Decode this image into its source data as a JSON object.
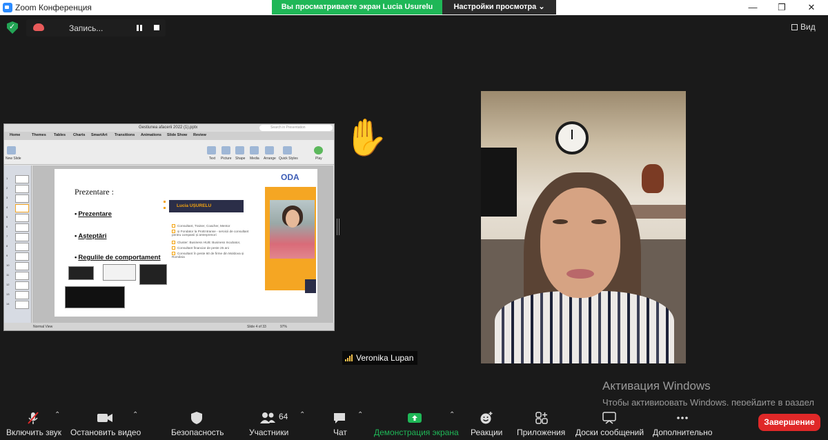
{
  "window": {
    "title": "Zoom Конференция",
    "controls": [
      "—",
      "❐",
      "✕"
    ]
  },
  "share_banner": {
    "text": "Вы просматриваете экран Lucia Usurelu",
    "view_settings": "Настройки просмотра"
  },
  "recording": {
    "label": "Запись..."
  },
  "view_button": "Вид",
  "shared_screen": {
    "file_name": "Gestiunea afacerii 2022 (1).pptx",
    "search_placeholder": "Search in Presentation",
    "tabs": [
      "Home",
      "Themes",
      "Tables",
      "Charts",
      "SmartArt",
      "Transitions",
      "Animations",
      "Slide Show",
      "Review"
    ],
    "ribbon_items": [
      "New Slide",
      "Text",
      "Picture",
      "Shape",
      "Media",
      "Arrange",
      "Quick Styles",
      "Play"
    ],
    "slide": {
      "title": "Prezentare :",
      "bullets": [
        "Prezentare",
        "Așteptări",
        "Regulile de comportament"
      ],
      "presenter_name": "Lucia UȘURELU",
      "bio": [
        "Consultant, Trainer, Coacher, Mentor",
        "și Fondator la ProEntranse - servicii de consultant pentru companii și antreprenori",
        "Cluster: Business HUB: Business Incubator,",
        "Consultant  financiar de peste 25 ani",
        "Consultant  în peste 60 de firme din Moldova și România"
      ],
      "logo": "ODA"
    },
    "status": {
      "view": "Normal View",
      "slide": "Slide 4 of 33",
      "zoom": "97%"
    }
  },
  "participant": {
    "name": "Veronika Lupan"
  },
  "windows_activation": {
    "title": "Активация Windows",
    "text": "Чтобы активировать Windows, перейдите в раздел \"Параметры\"."
  },
  "toolbar": {
    "unmute": "Включить звук",
    "stop_video": "Остановить видео",
    "security": "Безопасность",
    "participants": "Участники",
    "participants_count": "64",
    "chat": "Чат",
    "share_screen": "Демонстрация экрана",
    "reactions": "Реакции",
    "apps": "Приложения",
    "whiteboards": "Доски сообщений",
    "more": "Дополнительно",
    "end": "Завершение"
  },
  "colors": {
    "accent_green": "#1fb757",
    "end_red": "#e02828",
    "slide_orange": "#f5a623"
  }
}
